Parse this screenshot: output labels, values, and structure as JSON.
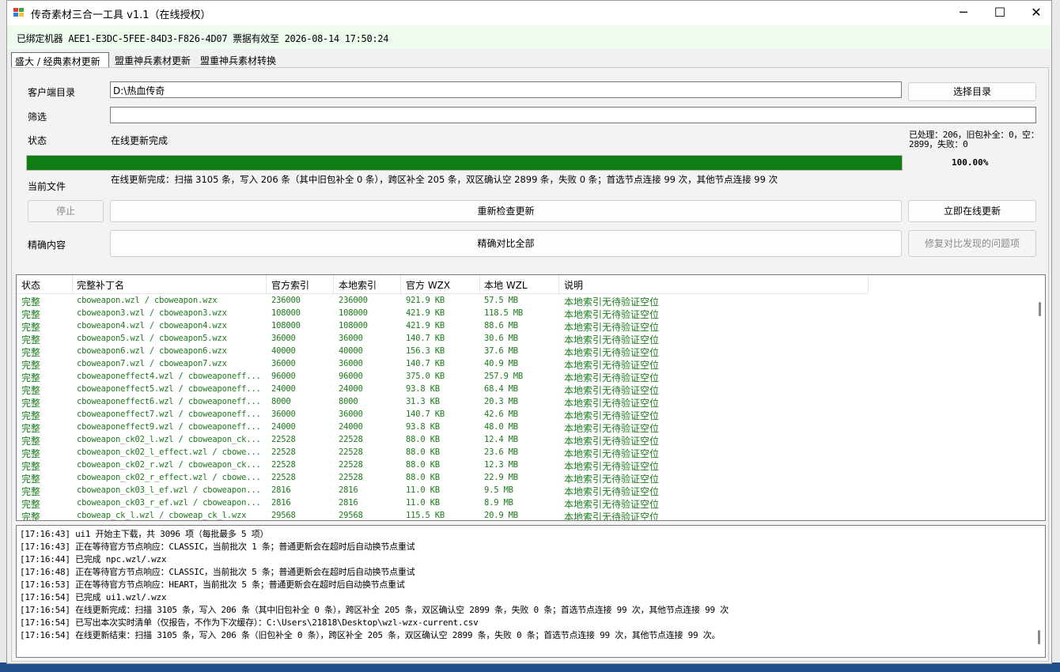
{
  "window": {
    "title": "传奇素材三合一工具 v1.1（在线授权）",
    "minimize_icon": "─",
    "maximize_icon": "☐",
    "close_icon": "✕"
  },
  "license_bar": {
    "text": "已绑定机器 AEE1-E3DC-5FEE-84D3-F826-4D07  票据有效至 2026-08-14 17:50:24"
  },
  "tabs": [
    {
      "label": "盛大 / 经典素材更新",
      "active": true
    },
    {
      "label": "盟重神兵素材更新",
      "active": false
    },
    {
      "label": "盟重神兵素材转换",
      "active": false
    }
  ],
  "form": {
    "client_dir_label": "客户端目录",
    "client_dir_value": "D:\\热血传奇",
    "choose_dir_button": "选择目录",
    "filter_label": "筛选",
    "filter_value": "",
    "status_label": "状态",
    "status_value": "在线更新完成",
    "stats_text": "已处理：206，旧包补全：0，空：2899，失败：0",
    "progress_percent": "100.00%",
    "progress_value": 100,
    "current_file_label": "当前文件",
    "current_file_value": "在线更新完成：扫描 3105 条，写入 206 条（其中旧包补全 0 条），跨区补全 205 条，双区确认空 2899 条，失败 0 条；首选节点连接 99 次，其他节点连接 99 次",
    "stop_button": "停止",
    "recheck_button": "重新检查更新",
    "update_now_button": "立即在线更新",
    "precise_label": "精确内容",
    "compare_all_button": "精确对比全部",
    "repair_button": "修复对比发现的问题项"
  },
  "table": {
    "headers": [
      "状态",
      "完整补丁名",
      "官方索引",
      "本地索引",
      "官方 WZX",
      "本地 WZL",
      "说明"
    ],
    "rows": [
      [
        "完整",
        "cboweapon.wzl / cboweapon.wzx",
        "236000",
        "236000",
        "921.9 KB",
        "57.5 MB",
        "本地索引无待验证空位"
      ],
      [
        "完整",
        "cboweapon3.wzl / cboweapon3.wzx",
        "108000",
        "108000",
        "421.9 KB",
        "118.5 MB",
        "本地索引无待验证空位"
      ],
      [
        "完整",
        "cboweapon4.wzl / cboweapon4.wzx",
        "108000",
        "108000",
        "421.9 KB",
        "88.6 MB",
        "本地索引无待验证空位"
      ],
      [
        "完整",
        "cboweapon5.wzl / cboweapon5.wzx",
        "36000",
        "36000",
        "140.7 KB",
        "30.6 MB",
        "本地索引无待验证空位"
      ],
      [
        "完整",
        "cboweapon6.wzl / cboweapon6.wzx",
        "40000",
        "40000",
        "156.3 KB",
        "37.6 MB",
        "本地索引无待验证空位"
      ],
      [
        "完整",
        "cboweapon7.wzl / cboweapon7.wzx",
        "36000",
        "36000",
        "140.7 KB",
        "40.9 MB",
        "本地索引无待验证空位"
      ],
      [
        "完整",
        "cboweaponeffect4.wzl / cboweaponeff...",
        "96000",
        "96000",
        "375.0 KB",
        "257.9 MB",
        "本地索引无待验证空位"
      ],
      [
        "完整",
        "cboweaponeffect5.wzl / cboweaponeff...",
        "24000",
        "24000",
        "93.8 KB",
        "68.4 MB",
        "本地索引无待验证空位"
      ],
      [
        "完整",
        "cboweaponeffect6.wzl / cboweaponeff...",
        "8000",
        "8000",
        "31.3 KB",
        "20.3 MB",
        "本地索引无待验证空位"
      ],
      [
        "完整",
        "cboweaponeffect7.wzl / cboweaponeff...",
        "36000",
        "36000",
        "140.7 KB",
        "42.6 MB",
        "本地索引无待验证空位"
      ],
      [
        "完整",
        "cboweaponeffect9.wzl / cboweaponeff...",
        "24000",
        "24000",
        "93.8 KB",
        "48.0 MB",
        "本地索引无待验证空位"
      ],
      [
        "完整",
        "cboweapon_ck02_l.wzl / cboweapon_ck...",
        "22528",
        "22528",
        "88.0 KB",
        "12.4 MB",
        "本地索引无待验证空位"
      ],
      [
        "完整",
        "cboweapon_ck02_l_effect.wzl / cbowe...",
        "22528",
        "22528",
        "88.0 KB",
        "23.6 MB",
        "本地索引无待验证空位"
      ],
      [
        "完整",
        "cboweapon_ck02_r.wzl / cboweapon_ck...",
        "22528",
        "22528",
        "88.0 KB",
        "12.3 MB",
        "本地索引无待验证空位"
      ],
      [
        "完整",
        "cboweapon_ck02_r_effect.wzl / cbowe...",
        "22528",
        "22528",
        "88.0 KB",
        "22.9 MB",
        "本地索引无待验证空位"
      ],
      [
        "完整",
        "cboweapon_ck03_l_ef.wzl / cboweapon...",
        "2816",
        "2816",
        "11.0 KB",
        "9.5 MB",
        "本地索引无待验证空位"
      ],
      [
        "完整",
        "cboweapon_ck03_r_ef.wzl / cboweapon...",
        "2816",
        "2816",
        "11.0 KB",
        "8.9 MB",
        "本地索引无待验证空位"
      ],
      [
        "完整",
        "cboweap_ck_l.wzl / cboweap_ck_l.wzx",
        "29568",
        "29568",
        "115.5 KB",
        "20.9 MB",
        "本地索引无待验证空位"
      ]
    ]
  },
  "log": [
    "[17:16:43] ui1 开始主下载，共 3096 项（每批最多 5 项）",
    "[17:16:43] 正在等待官方节点响应：CLASSIC，当前批次 1 条；普通更新会在超时后自动换节点重试",
    "[17:16:44] 已完成 npc.wzl/.wzx",
    "[17:16:48] 正在等待官方节点响应：CLASSIC，当前批次 5 条；普通更新会在超时后自动换节点重试",
    "[17:16:53] 正在等待官方节点响应：HEART，当前批次 5 条；普通更新会在超时后自动换节点重试",
    "[17:16:54] 已完成 ui1.wzl/.wzx",
    "[17:16:54] 在线更新完成：扫描 3105 条，写入 206 条（其中旧包补全 0 条），跨区补全 205 条，双区确认空 2899 条，失败 0 条；首选节点连接 99 次，其他节点连接 99 次",
    "[17:16:54] 已写出本次实时清单（仅报告，不作为下次缓存）：C:\\Users\\21818\\Desktop\\wzl-wzx-current.csv",
    "[17:16:54] 在线更新结束：扫描 3105 条，写入 206 条（旧包补全 0 条），跨区补全 205 条，双区确认空 2899 条，失败 0 条；首选节点连接 99 次，其他节点连接 99 次。"
  ],
  "colors": {
    "progress_fill": "#0e7e14",
    "row_text": "#1c7c1c",
    "license_bar_bg": "#f0fbef"
  }
}
